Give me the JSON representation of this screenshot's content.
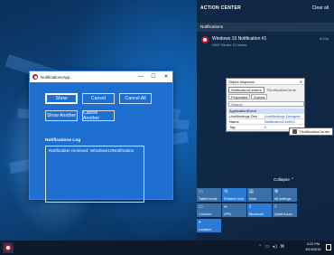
{
  "app_window": {
    "title": "NotificationsApp",
    "controls": {
      "minimize": "—",
      "maximize": "☐",
      "close": "✕"
    },
    "buttons": {
      "show": "Show",
      "cancel": "Cancel",
      "cancel_all": "Cancel All",
      "show_another": "Show Another",
      "cancel_another": "Cancel Another"
    },
    "log_label": "Notifications Log",
    "log_text": "Notification received: Windows10Notification"
  },
  "action_center": {
    "title": "ACTION CENTER",
    "clear_all": "Clear all",
    "section": "Notifications",
    "notification": {
      "title": "Windows 10 Notification #1",
      "subtitle": "NSO Studio 10 Inside",
      "time": "4:22p"
    },
    "collapse": "Collapse",
    "tiles": [
      {
        "label": "Tablet mode",
        "icon": "▭"
      },
      {
        "label": "Rotation lock",
        "icon": "⟲"
      },
      {
        "label": "Note",
        "icon": "▤"
      },
      {
        "label": "All settings",
        "icon": "⚙"
      },
      {
        "label": "Connect",
        "icon": "▭"
      },
      {
        "label": "VPN",
        "icon": "∞"
      },
      {
        "label": "Bluetooth",
        "icon": "ᛒ"
      },
      {
        "label": "Quiet hours",
        "icon": "☾"
      },
      {
        "label": "Location",
        "icon": "⌖"
      }
    ]
  },
  "object_inspector": {
    "title": "Object Inspector",
    "selected_object": "NotificationCenter1",
    "selected_type": "TNotificationCente",
    "tabs": [
      "Properties",
      "Events"
    ],
    "search_placeholder": "Search",
    "rows": [
      {
        "name": "ApplicationEvent",
        "value": ""
      },
      {
        "name": "LiveBindings Des",
        "value": "LiveBindings Designer"
      },
      {
        "name": "Name",
        "value": "NotificationCenter1"
      },
      {
        "name": "Tag",
        "value": "0"
      }
    ]
  },
  "tooltip": {
    "text": "TNotificationCenter"
  },
  "taskbar": {
    "tray_icons": "⌃ ▭ ◂) ⌘",
    "time": "4:22 PM",
    "date": "8/14/2015"
  }
}
